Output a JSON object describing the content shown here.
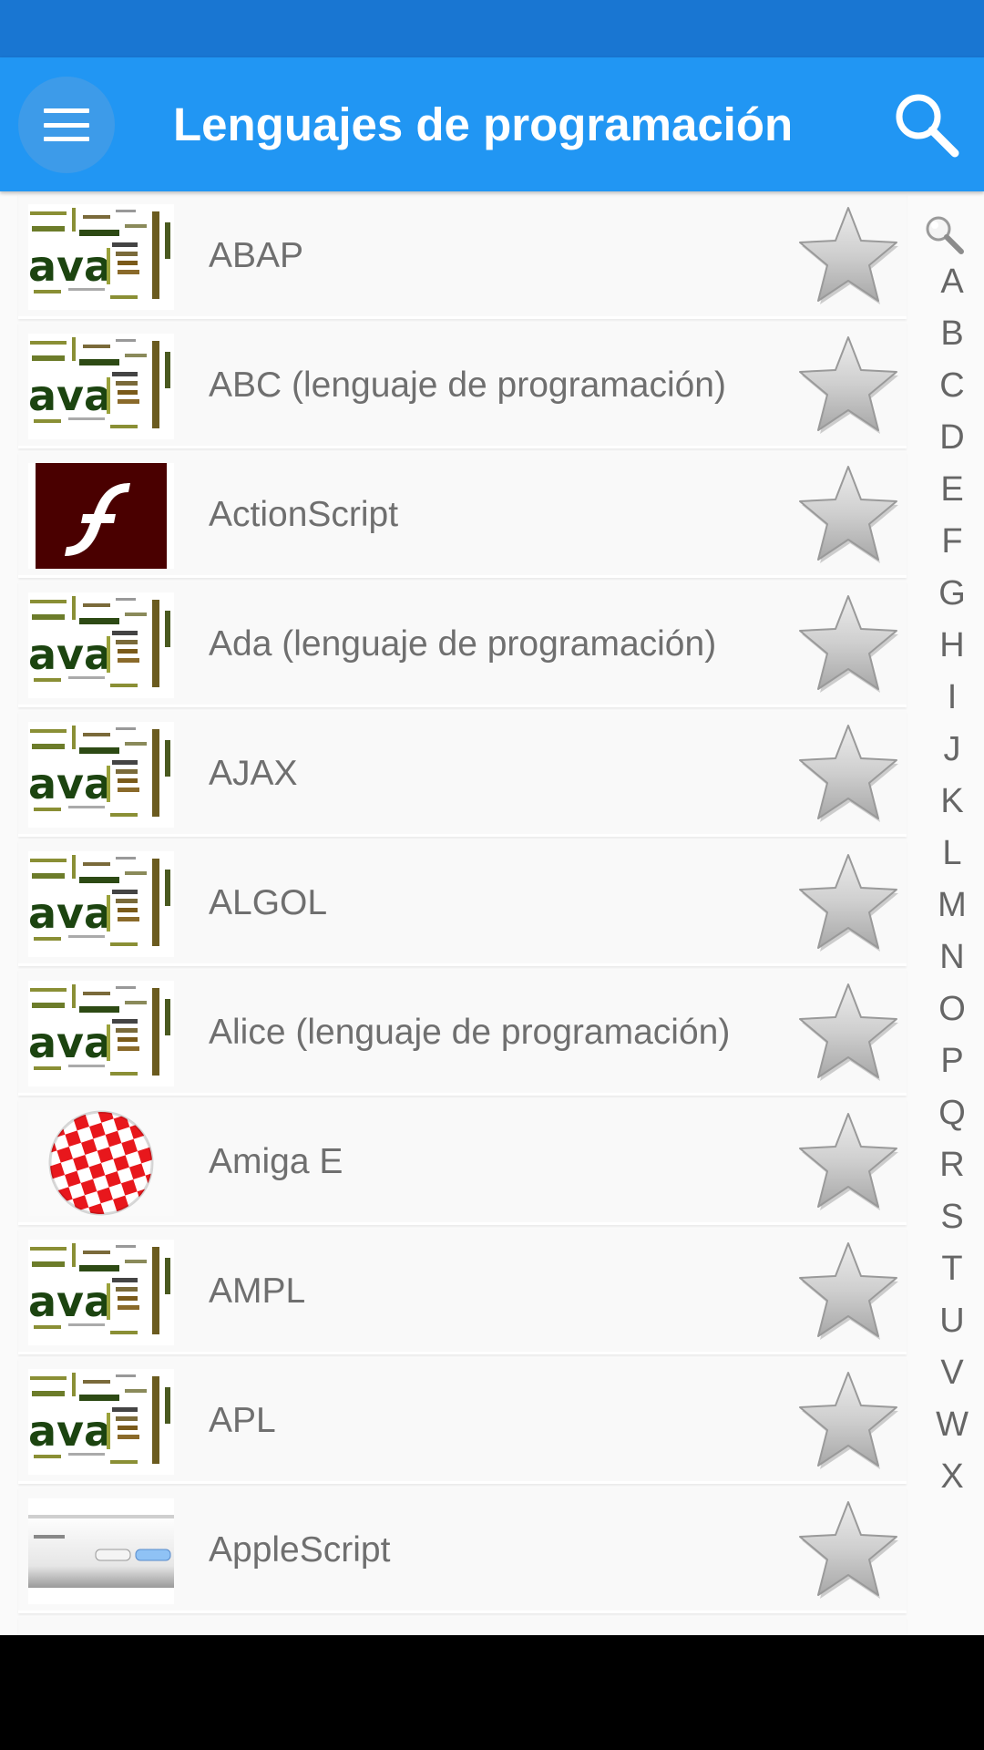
{
  "app_bar": {
    "title": "Lenguajes de programación",
    "menu_icon": "hamburger-menu-icon",
    "search_icon": "search-icon"
  },
  "colors": {
    "status_bar": "#1976D2",
    "app_bar": "#2196F3",
    "row_background": "#f9f9f9",
    "label_text": "#6f6f6f"
  },
  "list": {
    "items": [
      {
        "label": "ABAP",
        "thumbnail": "wordcloud"
      },
      {
        "label": "ABC (lenguaje de programación)",
        "thumbnail": "wordcloud"
      },
      {
        "label": "ActionScript",
        "thumbnail": "flash"
      },
      {
        "label": "Ada (lenguaje de programación)",
        "thumbnail": "wordcloud"
      },
      {
        "label": "AJAX",
        "thumbnail": "wordcloud"
      },
      {
        "label": "ALGOL",
        "thumbnail": "wordcloud"
      },
      {
        "label": "Alice (lenguaje de programación)",
        "thumbnail": "wordcloud"
      },
      {
        "label": "Amiga E",
        "thumbnail": "amiga-ball"
      },
      {
        "label": "AMPL",
        "thumbnail": "wordcloud"
      },
      {
        "label": "APL",
        "thumbnail": "wordcloud"
      },
      {
        "label": "AppleScript",
        "thumbnail": "dialog"
      }
    ],
    "favorite_icon": "star-icon"
  },
  "alphabet_index": {
    "search_icon": "magnifier-icon",
    "letters": [
      "A",
      "B",
      "C",
      "D",
      "E",
      "F",
      "G",
      "H",
      "I",
      "J",
      "K",
      "L",
      "M",
      "N",
      "O",
      "P",
      "Q",
      "R",
      "S",
      "T",
      "U",
      "V",
      "W",
      "X"
    ]
  }
}
